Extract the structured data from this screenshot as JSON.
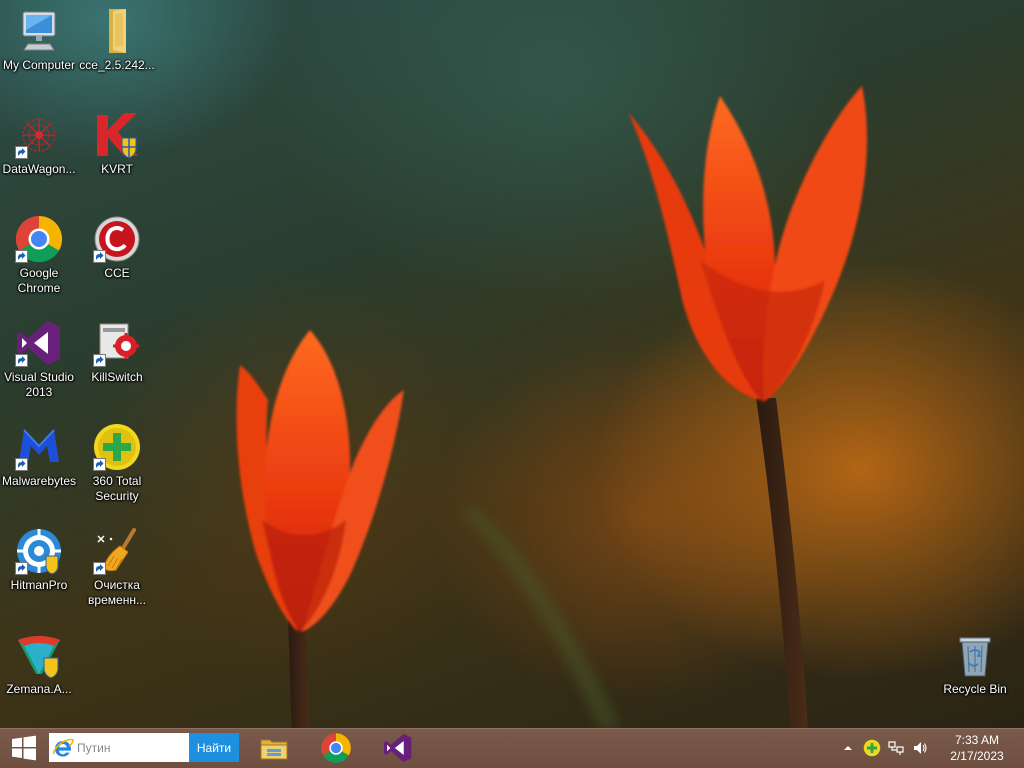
{
  "desktop_icons": [
    {
      "id": "my-computer",
      "label": "My Computer"
    },
    {
      "id": "cce-folder",
      "label": "cce_2.5.242..."
    },
    {
      "id": "datawagon",
      "label": "DataWagon..."
    },
    {
      "id": "kvrt",
      "label": "KVRT"
    },
    {
      "id": "google-chrome",
      "label": "Google Chrome"
    },
    {
      "id": "cce",
      "label": "CCE"
    },
    {
      "id": "visual-studio",
      "label": "Visual Studio 2013"
    },
    {
      "id": "killswitch",
      "label": "KillSwitch"
    },
    {
      "id": "malwarebytes",
      "label": "Malwarebytes"
    },
    {
      "id": "total-security",
      "label": "360 Total Security"
    },
    {
      "id": "hitmanpro",
      "label": "HitmanPro"
    },
    {
      "id": "temp-cleaner",
      "label": "Очистка временн..."
    },
    {
      "id": "zemana",
      "label": "Zemana.A..."
    },
    {
      "id": "recycle-bin",
      "label": "Recycle Bin"
    }
  ],
  "taskbar": {
    "search": {
      "placeholder": "Путин",
      "value": ""
    },
    "search_button_label": "Найти",
    "pinned": [
      "file-explorer-icon",
      "chrome-icon",
      "visual-studio-icon"
    ],
    "tray": {
      "time": "7:33 AM",
      "date": "2/17/2023"
    }
  },
  "colors": {
    "taskbar_bg": "#6e4f40",
    "search_button_bg": "#1e90e0",
    "tulip_red": "#e83010"
  }
}
